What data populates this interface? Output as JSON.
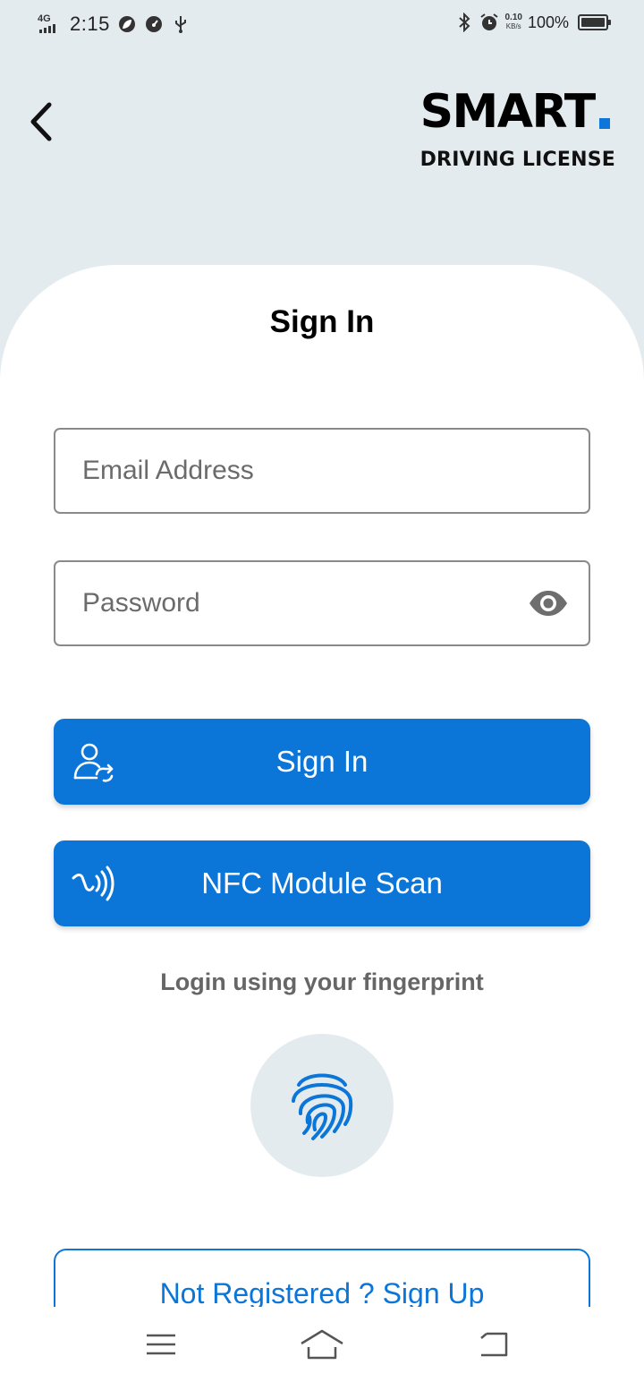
{
  "status_bar": {
    "network": "4G",
    "time": "2:15",
    "speed_value": "0.10",
    "speed_unit": "KB/s",
    "battery": "100%",
    "icons": [
      "signal-icon",
      "leaf-app-icon",
      "speedometer-app-icon",
      "usb-icon",
      "bluetooth-icon",
      "alarm-icon",
      "battery-icon"
    ]
  },
  "header": {
    "back_icon": "chevron-left-icon",
    "brand_name": "SMART",
    "brand_tagline": "DRIVING LICENSE",
    "brand_dot_color": "#0d77d9"
  },
  "form": {
    "title": "Sign In",
    "email_placeholder": "Email Address",
    "email_value": "",
    "password_placeholder": "Password",
    "password_value": "",
    "password_toggle_icon": "eye-icon"
  },
  "actions": {
    "sign_in_label": "Sign In",
    "sign_in_icon": "user-login-icon",
    "nfc_label": "NFC Module Scan",
    "nfc_icon": "nfc-icon",
    "fingerprint_caption": "Login using your fingerprint",
    "fingerprint_icon": "fingerprint-icon",
    "signup_label": "Not Registered ? Sign Up"
  },
  "colors": {
    "accent": "#0b76d8",
    "header_bg": "#e4ebef",
    "card_bg": "#ffffff"
  },
  "nav_bar": {
    "icons": [
      "menu-icon",
      "home-icon",
      "back-icon"
    ]
  }
}
